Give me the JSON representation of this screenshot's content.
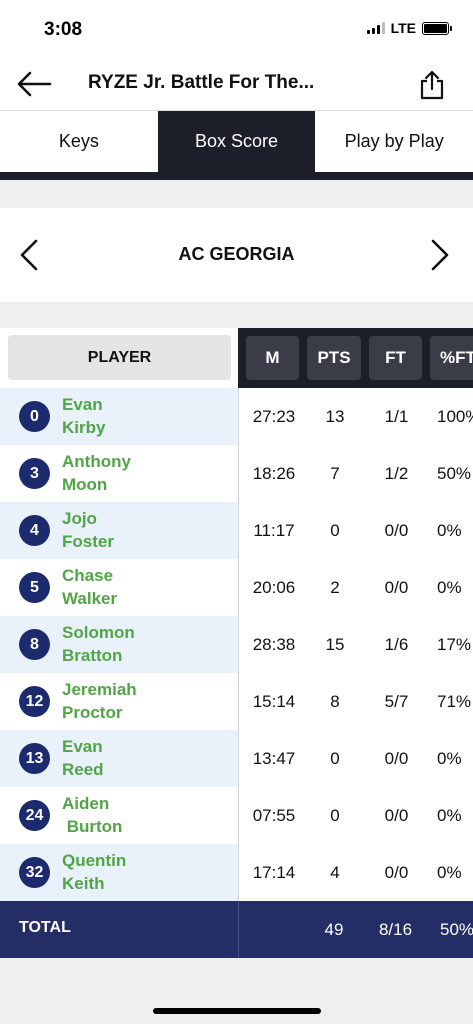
{
  "status": {
    "time": "3:08",
    "network": "LTE"
  },
  "nav": {
    "title": "RYZE Jr. Battle For The..."
  },
  "tabs": [
    {
      "label": "Keys",
      "active": false
    },
    {
      "label": "Box Score",
      "active": true
    },
    {
      "label": "Play by Play",
      "active": false
    }
  ],
  "team": {
    "name": "AC GEORGIA"
  },
  "table": {
    "player_header": "PLAYER",
    "columns": [
      "M",
      "PTS",
      "FT",
      "%FT"
    ],
    "rows": [
      {
        "number": "0",
        "name": "Evan\nKirby",
        "m": "27:23",
        "pts": "13",
        "ft": "1/1",
        "pct": "100%"
      },
      {
        "number": "3",
        "name": "Anthony\nMoon",
        "m": "18:26",
        "pts": "7",
        "ft": "1/2",
        "pct": "50%"
      },
      {
        "number": "4",
        "name": "Jojo\nFoster",
        "m": "11:17",
        "pts": "0",
        "ft": "0/0",
        "pct": "0%"
      },
      {
        "number": "5",
        "name": "Chase\nWalker",
        "m": "20:06",
        "pts": "2",
        "ft": "0/0",
        "pct": "0%"
      },
      {
        "number": "8",
        "name": "Solomon\nBratton",
        "m": "28:38",
        "pts": "15",
        "ft": "1/6",
        "pct": "17%"
      },
      {
        "number": "12",
        "name": "Jeremiah\nProctor",
        "m": "15:14",
        "pts": "8",
        "ft": "5/7",
        "pct": "71%"
      },
      {
        "number": "13",
        "name": "Evan\nReed",
        "m": "13:47",
        "pts": "0",
        "ft": "0/0",
        "pct": "0%"
      },
      {
        "number": "24",
        "name": "Aiden\n Burton",
        "m": "07:55",
        "pts": "0",
        "ft": "0/0",
        "pct": "0%"
      },
      {
        "number": "32",
        "name": "Quentin\nKeith",
        "m": "17:14",
        "pts": "4",
        "ft": "0/0",
        "pct": "0%"
      }
    ],
    "total": {
      "label": "TOTAL",
      "pts": "49",
      "ft": "8/16",
      "pct": "50%"
    }
  },
  "colors": {
    "dark": "#1c1f2a",
    "navy": "#242d66",
    "green": "#52a547",
    "row_alt": "#e9f1fb"
  }
}
